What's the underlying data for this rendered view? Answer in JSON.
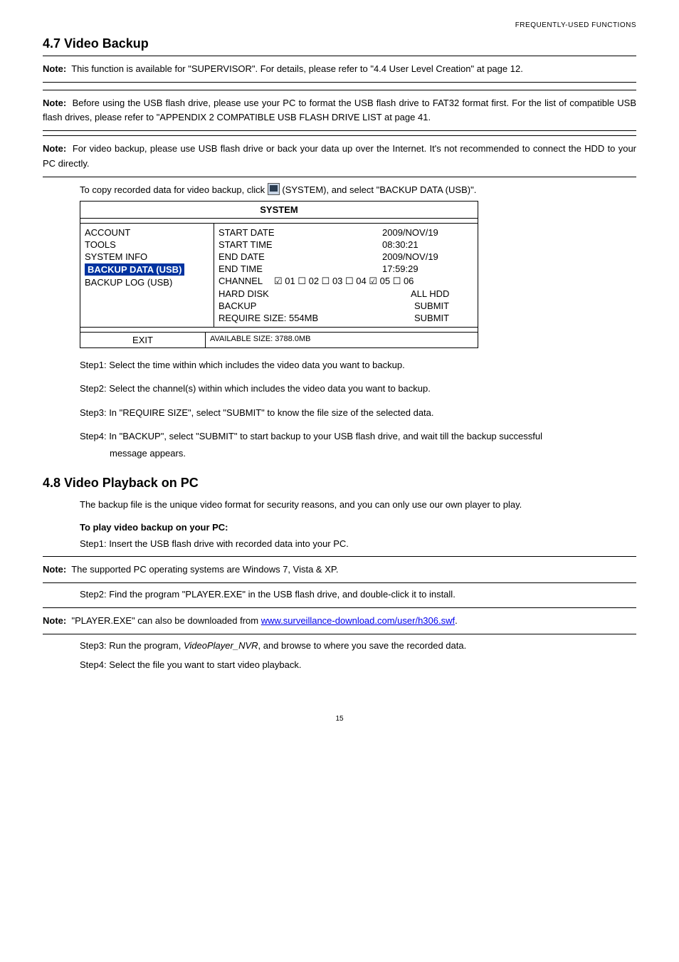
{
  "header_right": "FREQUENTLY-USED FUNCTIONS",
  "section47_title": "4.7 Video Backup",
  "note1_label": "Note:",
  "note1_text": "This function is available for \"SUPERVISOR\". For details, please refer to \"4.4 User Level Creation\" at page 12.",
  "note2_label": "Note:",
  "note2_text": "Before using the USB flash drive, please use your PC to format the USB flash drive to FAT32 format first. For the list of compatible USB flash drives, please refer to \"APPENDIX 2 COMPATIBLE USB FLASH DRIVE LIST at page 41.",
  "note3_label": "Note:",
  "note3_text": "For video backup, please use USB flash drive or back your data up over the Internet. It's not recommended to connect the HDD to your PC directly.",
  "sys_lead_pre": "To copy recorded data for video backup, click ",
  "sys_lead_post": " (SYSTEM), and select \"BACKUP DATA (USB)\".",
  "sys": {
    "title": "SYSTEM",
    "left_items": [
      "ACCOUNT",
      "TOOLS",
      "SYSTEM INFO"
    ],
    "left_highlight": "BACKUP DATA (USB)",
    "left_after": [
      "BACKUP LOG (USB)"
    ],
    "rows": [
      {
        "lbl": "START DATE",
        "val": "2009/NOV/19"
      },
      {
        "lbl": "START TIME",
        "val": "08:30:21"
      },
      {
        "lbl": "END DATE",
        "val": "2009/NOV/19"
      },
      {
        "lbl": "END TIME",
        "val": "17:59:29"
      }
    ],
    "channel_lbl": "CHANNEL",
    "channel_opts": "☑ 01  ☐ 02  ☐ 03  ☐ 04  ☑ 05  ☐ 06",
    "harddisk_lbl": "HARD DISK",
    "harddisk_val": "ALL HDD",
    "backup_lbl": "BACKUP",
    "backup_val": "SUBMIT",
    "reqsize_lbl": "REQUIRE SIZE: 554MB",
    "reqsize_val": "SUBMIT",
    "exit": "EXIT",
    "avail": "AVAILABLE SIZE: 3788.0MB"
  },
  "step1": "Step1: Select the time within which includes the video data you want to backup.",
  "step2": "Step2: Select the channel(s) within which includes the video data you want to backup.",
  "step3": "Step3: In \"REQUIRE SIZE\", select \"SUBMIT\" to know the file size of the selected data.",
  "step4a": "Step4: In \"BACKUP\", select \"SUBMIT\" to start backup to your USB flash drive, and wait till the backup successful",
  "step4b": "message appears.",
  "section48_title": "4.8 Video Playback on PC",
  "para48_1": "The backup file is the unique video format for security reasons, and you can only use our own player to play.",
  "para48_bold": "To play video backup on your PC:",
  "step48_1": "Step1: Insert the USB flash drive with recorded data into your PC.",
  "note4_label": "Note:",
  "note4_text": "The supported PC operating systems are Windows 7, Vista & XP.",
  "step48_2": "Step2: Find the program \"PLAYER.EXE\" in the USB flash drive, and double-click it to install.",
  "note5_label": "Note:",
  "note5_pre": "\"PLAYER.EXE\" can also be downloaded from ",
  "note5_link": "www.surveillance-download.com/user/h306.swf",
  "note5_post": ".",
  "step48_3_pre": "Step3: Run the program, ",
  "step48_3_it": "VideoPlayer_NVR",
  "step48_3_post": ", and browse to where you save the recorded data.",
  "step48_4": "Step4: Select the file you want to start video playback.",
  "page_no": "15"
}
